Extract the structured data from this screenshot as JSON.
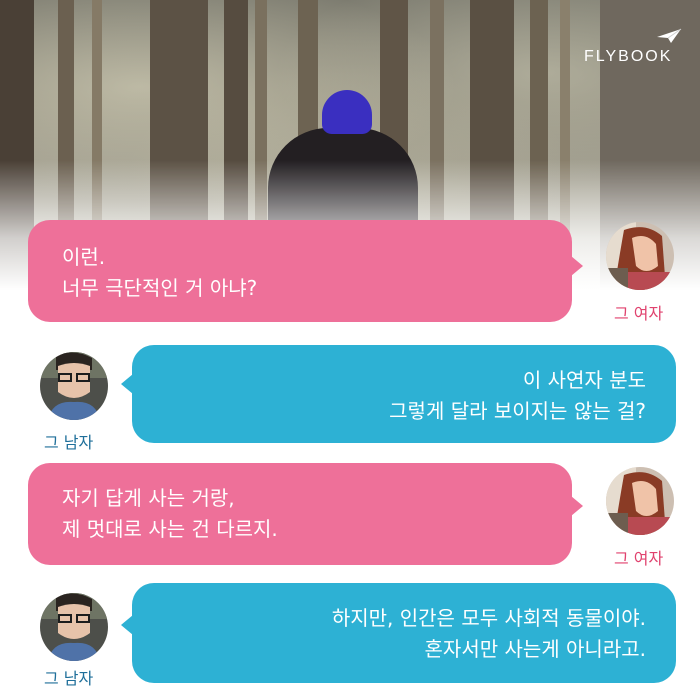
{
  "brand": {
    "logo_text": "FLYBOOK",
    "logo_icon": "paper-plane-icon"
  },
  "colors": {
    "pink_bubble": "#ee7099",
    "blue_bubble": "#2db1d4",
    "woman_caption": "#e0426e",
    "man_caption": "#1f6f9a"
  },
  "conversation": [
    {
      "speaker": "그 여자",
      "lines": [
        "이런.",
        "너무 극단적인 거 아냐?"
      ]
    },
    {
      "speaker": "그 남자",
      "lines": [
        "이 사연자 분도",
        "그렇게 달라 보이지는 않는 걸?"
      ]
    },
    {
      "speaker": "그 여자",
      "lines": [
        "자기 답게 사는 거랑,",
        "제 멋대로 사는 건 다르지."
      ]
    },
    {
      "speaker": "그 남자",
      "lines": [
        "하지만, 인간은 모두 사회적 동물이야.",
        "혼자서만 사는게 아니라고."
      ]
    }
  ]
}
